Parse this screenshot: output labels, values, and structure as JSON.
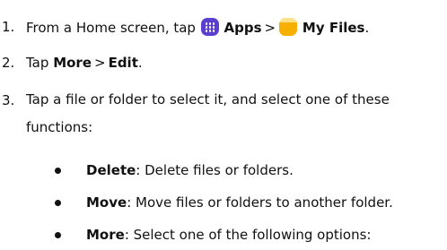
{
  "steps": [
    {
      "num": "1.",
      "pre": "From a Home screen, tap",
      "apps_label": "Apps",
      "separator": ">",
      "files_label": "My Files",
      "end": "."
    },
    {
      "num": "2.",
      "pre": "Tap",
      "more_label": "More",
      "separator": ">",
      "edit_label": "Edit",
      "end": "."
    },
    {
      "num": "3.",
      "text": "Tap a file or folder to select it, and select one of these functions:"
    }
  ],
  "functions": [
    {
      "label": "Delete",
      "desc": ": Delete files or folders."
    },
    {
      "label": "Move",
      "desc": ": Move files or folders to another folder."
    },
    {
      "label": "More",
      "desc": ": Select one of the following options:"
    }
  ],
  "icons": {
    "apps": "apps-grid-icon",
    "my_files": "folder-icon"
  },
  "colors": {
    "text": "#111111",
    "apps_icon": "#5b3fd0",
    "files_icon": "#fbc315"
  }
}
